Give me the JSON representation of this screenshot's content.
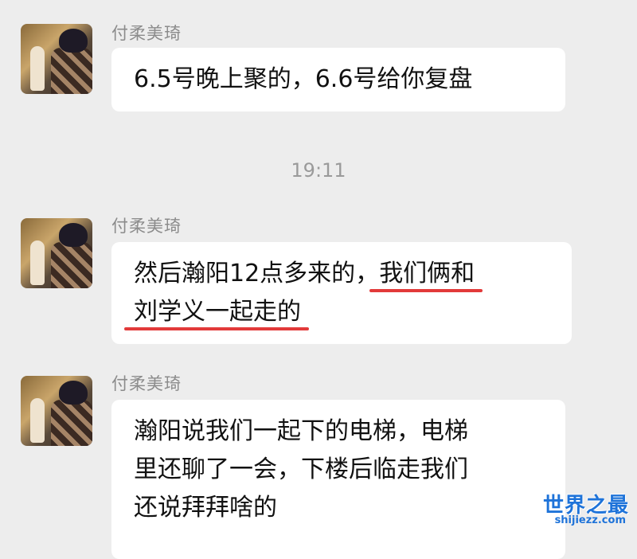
{
  "colors": {
    "background": "#ededed",
    "bubble": "#ffffff",
    "underline": "#e23a3a",
    "name": "#8b8b8b"
  },
  "messages": [
    {
      "sender": "付柔美琦",
      "avatar_icon": "avatar-photo",
      "lines": [
        "6.5号晚上聚的，6.6号给你复盘"
      ]
    },
    {
      "sender": "付柔美琦",
      "avatar_icon": "avatar-photo",
      "line1_plain": "然后瀚阳12点多来的，",
      "line1_underlined": "我们俩和",
      "line2_underlined": "刘学义一起走的"
    },
    {
      "sender": "付柔美琦",
      "avatar_icon": "avatar-photo",
      "lines": [
        "瀚阳说我们一起下的电梯，电梯",
        "里还聊了一会，下楼后临走我们",
        "还说拜拜啥的"
      ]
    }
  ],
  "timestamp": "19:11",
  "watermark": {
    "main": "世界之最",
    "sub": "shijiezz.com"
  }
}
